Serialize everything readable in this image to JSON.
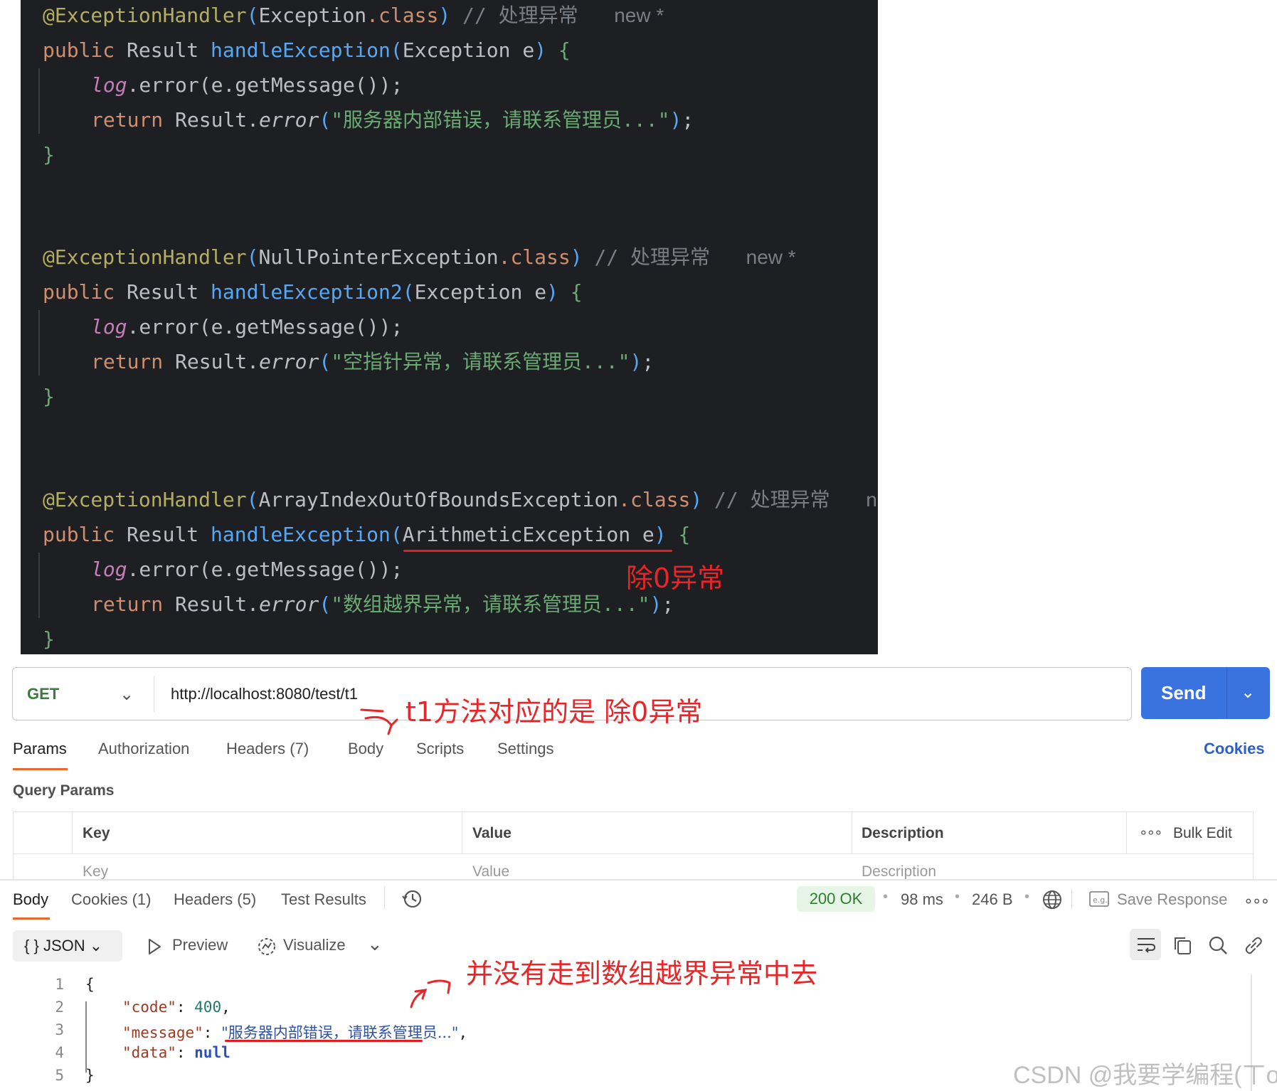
{
  "code": {
    "block1": {
      "annotation": "@ExceptionHandler",
      "paren_open": "(",
      "arg": "Exception",
      "class_kw": ".class",
      "paren_close": ")",
      "comment": "// 处理异常",
      "new_marker": "new *",
      "kw_public": "public",
      "type": "Result",
      "method": "handleException",
      "param_type": "Exception",
      "param_name": "e",
      "log": "log",
      "log_call": ".error(",
      "log_arg": "e.getMessage()",
      "log_close": ");",
      "kw_return": "return",
      "ret_obj": "Result.",
      "ret_method": "error",
      "ret_str": "\"服务器内部错误，请联系管理员...\"",
      "close_brace": "}"
    },
    "block2": {
      "annotation": "@ExceptionHandler",
      "arg": "NullPointerException",
      "class_kw": ".class",
      "comment": "// 处理异常",
      "new_marker": "new *",
      "kw_public": "public",
      "type": "Result",
      "method": "handleException2",
      "param_type": "Exception",
      "param_name": "e",
      "log": "log",
      "log_call": ".error(",
      "log_arg": "e.getMessage()",
      "log_close": ");",
      "kw_return": "return",
      "ret_obj": "Result.",
      "ret_method": "error",
      "ret_str": "\"空指针异常，请联系管理员...\"",
      "close_brace": "}"
    },
    "block3": {
      "annotation": "@ExceptionHandler",
      "arg": "ArrayIndexOutOfBoundsException",
      "class_kw": ".class",
      "comment": "// 处理异常",
      "new_marker": "ne",
      "kw_public": "public",
      "type": "Result",
      "method": "handleException",
      "param_type": "ArithmeticException",
      "param_name": "e",
      "log": "log",
      "log_call": ".error(",
      "log_arg": "e.getMessage()",
      "log_close": ");",
      "kw_return": "return",
      "ret_obj": "Result.",
      "ret_method": "error",
      "ret_str": "\"数组越界异常，请联系管理员...\"",
      "close_brace": "}"
    }
  },
  "annotations": {
    "div_zero": "除0异常",
    "t1_note": "t1方法对应的是 除0异常",
    "not_reached": "并没有走到数组越界异常中去"
  },
  "request": {
    "method": "GET",
    "url": "http://localhost:8080/test/t1",
    "send_label": "Send"
  },
  "request_tabs": [
    "Params",
    "Authorization",
    "Headers (7)",
    "Body",
    "Scripts",
    "Settings"
  ],
  "cookies_link": "Cookies",
  "query_params": {
    "title": "Query Params",
    "headers": {
      "key": "Key",
      "value": "Value",
      "description": "Description",
      "bulk_edit": "Bulk Edit"
    },
    "placeholders": {
      "key": "Key",
      "value": "Value",
      "description": "Description"
    }
  },
  "response": {
    "tabs": [
      "Body",
      "Cookies (1)",
      "Headers (5)",
      "Test Results"
    ],
    "status": "200 OK",
    "time": "98 ms",
    "size": "246 B",
    "save_response": "Save Response",
    "format": "JSON",
    "preview": "Preview",
    "visualize": "Visualize",
    "body_lines": {
      "open": "{",
      "code_key": "\"code\"",
      "code_val": "400",
      "message_key": "\"message\"",
      "message_val": "\"服务器内部错误，请联系管理员...\"",
      "data_key": "\"data\"",
      "data_val": "null",
      "close": "}"
    },
    "line_numbers": [
      "1",
      "2",
      "3",
      "4",
      "5"
    ]
  },
  "watermark": "CSDN @我要学编程(ㄒoㄒ)",
  "colors": {
    "editor_bg": "#1e1f22",
    "send_button": "#3a73e0",
    "annotation_red": "#e8262a",
    "status_ok": "#2f7d2f"
  }
}
